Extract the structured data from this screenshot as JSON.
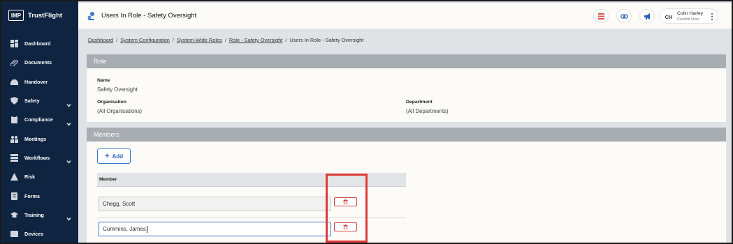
{
  "logo": {
    "badge": "IMP",
    "brand": "TrustFlight"
  },
  "sidebar": {
    "items": [
      {
        "label": "Dashboard",
        "icon": "dashboard-icon",
        "chevron": false
      },
      {
        "label": "Documents",
        "icon": "paperclip-icon",
        "chevron": false
      },
      {
        "label": "Handover",
        "icon": "inbox-icon",
        "chevron": false
      },
      {
        "label": "Safety",
        "icon": "shield-icon",
        "chevron": true
      },
      {
        "label": "Compliance",
        "icon": "clipboard-icon",
        "chevron": true
      },
      {
        "label": "Meetings",
        "icon": "people-icon",
        "chevron": false
      },
      {
        "label": "Workflows",
        "icon": "stack-icon",
        "chevron": true
      },
      {
        "label": "Risk",
        "icon": "warning-icon",
        "chevron": false
      },
      {
        "label": "Forms",
        "icon": "form-icon",
        "chevron": false
      },
      {
        "label": "Training",
        "icon": "graduation-cap-icon",
        "chevron": true
      },
      {
        "label": "Devices",
        "icon": "device-icon",
        "chevron": false
      }
    ]
  },
  "header": {
    "title": "Users In Role - Safety Oversight",
    "user": {
      "initials": "CH",
      "name": "Colin Harley",
      "role": "Centrik User"
    }
  },
  "breadcrumb": [
    {
      "label": "Dashboard",
      "link": true
    },
    {
      "label": "System Configuration",
      "link": true
    },
    {
      "label": "System-Wide Roles",
      "link": true
    },
    {
      "label": "Role - Safety Oversight",
      "link": true
    },
    {
      "label": "Users In Role - Safety Oversight",
      "link": false
    }
  ],
  "role_panel": {
    "header": "Role",
    "name_label": "Name",
    "name_value": "Safety Oversight",
    "org_label": "Organisation",
    "org_value": "(All Organisations)",
    "dept_label": "Department",
    "dept_value": "(All Departments)"
  },
  "members_panel": {
    "header": "Members",
    "add_label": "Add",
    "column_member": "Member",
    "rows": [
      {
        "member": "Chegg, Scott"
      },
      {
        "member": "Cummins, James"
      }
    ]
  },
  "colors": {
    "sidebar_bg": "#0f2440",
    "accent": "#3b76c9",
    "danger": "#cc4444",
    "highlight": "#e03c3c"
  }
}
